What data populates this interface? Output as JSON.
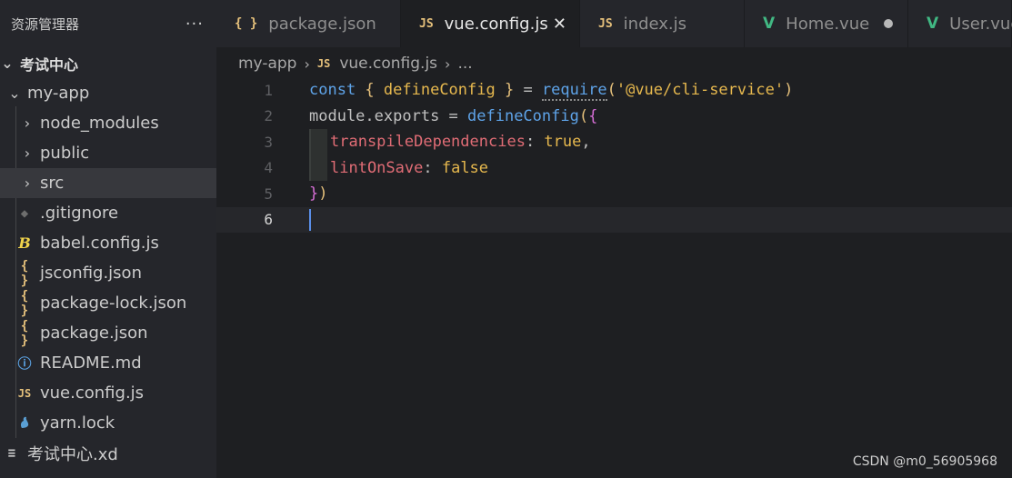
{
  "sidebar": {
    "title": "资源管理器",
    "more": "···",
    "root_label": "考试中心",
    "project": "my-app",
    "items": [
      {
        "label": "node_modules",
        "icon": "chevron-right-icon"
      },
      {
        "label": "public",
        "icon": "chevron-right-icon"
      },
      {
        "label": "src",
        "icon": "chevron-right-icon"
      },
      {
        "label": ".gitignore",
        "icon": "git-icon"
      },
      {
        "label": "babel.config.js",
        "icon": "babel-icon"
      },
      {
        "label": "jsconfig.json",
        "icon": "json-icon"
      },
      {
        "label": "package-lock.json",
        "icon": "json-icon"
      },
      {
        "label": "package.json",
        "icon": "json-icon"
      },
      {
        "label": "README.md",
        "icon": "info-icon"
      },
      {
        "label": "vue.config.js",
        "icon": "js-icon"
      },
      {
        "label": "yarn.lock",
        "icon": "yarn-icon"
      }
    ],
    "outside_file": "考试中心.xd"
  },
  "icons": {
    "json": "{ }",
    "js": "JS",
    "git": "◆",
    "babel": "B",
    "info": "ⓘ",
    "yarn": "🐈",
    "lines": "≡",
    "vue": "V",
    "chevron_right": "›",
    "chevron_down": "⌄",
    "close": "✕",
    "breadcrumb_sep": "›"
  },
  "tabs": [
    {
      "label": "package.json",
      "icon": "json-icon",
      "active": false
    },
    {
      "label": "vue.config.js",
      "icon": "js-icon",
      "active": true
    },
    {
      "label": "index.js",
      "icon": "js-icon",
      "active": false
    },
    {
      "label": "Home.vue",
      "icon": "vue-icon",
      "active": false,
      "modified": true
    },
    {
      "label": "User.vue",
      "icon": "vue-icon",
      "active": false
    }
  ],
  "breadcrumb": {
    "folder": "my-app",
    "file": "vue.config.js",
    "more": "..."
  },
  "editor": {
    "line_numbers": [
      "1",
      "2",
      "3",
      "4",
      "5",
      "6"
    ],
    "current_line": 6,
    "line1": {
      "t1": "const ",
      "t2": "{ ",
      "t3": "defineConfig",
      "t4": " } ",
      "t5": "= ",
      "t6": "require",
      "t7": "(",
      "t8": "'@vue/cli-service'",
      "t9": ")"
    },
    "line2": {
      "t1": "module",
      "t2": ".exports = ",
      "t3": "defineConfig",
      "t4": "(",
      "t5": "{"
    },
    "line3": {
      "t1": "transpileDependencies",
      "t2": ": ",
      "t3": "true",
      "t4": ","
    },
    "line4": {
      "t1": "lintOnSave",
      "t2": ": ",
      "t3": "false"
    },
    "line5": {
      "t1": "}",
      "t2": ")"
    }
  },
  "colors": {
    "keyword": "#5ea3e8",
    "function": "#e6b84e",
    "property": "#e06c75",
    "vue_green": "#41b883",
    "cursor": "#5a8ee8"
  },
  "watermark": "CSDN @m0_56905968"
}
